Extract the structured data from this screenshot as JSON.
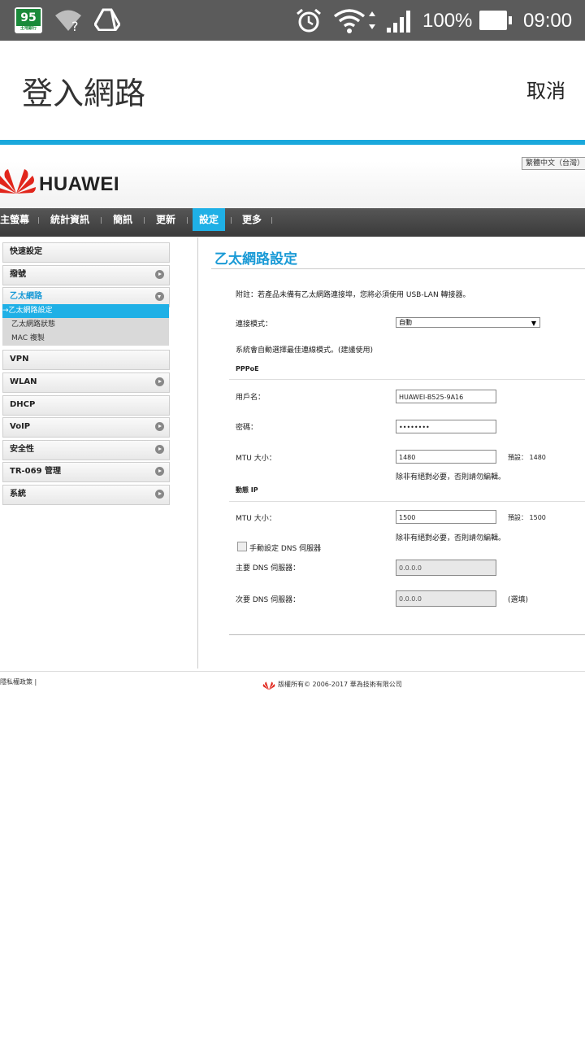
{
  "status_bar": {
    "app_icon_text": "95",
    "app_icon_subtext": "土地銀行",
    "battery_percent": "100%",
    "battery_level": 1.0,
    "time": "09:00",
    "icons": [
      "wifi-unknown-icon",
      "drive-icon",
      "alarm-icon",
      "wifi-icon",
      "signal-icon",
      "battery-icon"
    ]
  },
  "app_bar": {
    "title": "登入網路",
    "cancel_label": "取消",
    "accent_color": "#1aa8dc"
  },
  "router": {
    "language_selector": "繁體中文（台灣）",
    "brand": "HUAWEI",
    "nav": {
      "items": [
        {
          "label": "主螢幕"
        },
        {
          "label": "統計資訊"
        },
        {
          "label": "簡訊"
        },
        {
          "label": "更新"
        },
        {
          "label": "設定"
        },
        {
          "label": "更多"
        }
      ],
      "active_index": 4,
      "active_color": "#1fb0e6"
    },
    "sidebar": {
      "items": [
        {
          "label": "快速設定"
        },
        {
          "label": "撥號"
        },
        {
          "label": "乙太網路"
        },
        {
          "label": "VPN"
        },
        {
          "label": "WLAN"
        },
        {
          "label": "DHCP"
        },
        {
          "label": "VoIP"
        },
        {
          "label": "安全性"
        },
        {
          "label": "TR-069 管理"
        },
        {
          "label": "系統"
        }
      ],
      "sub_items": [
        {
          "label": "→乙太網路設定"
        },
        {
          "label": "乙太網路狀態"
        },
        {
          "label": "MAC 複製"
        }
      ]
    },
    "main": {
      "heading": "乙太網路設定",
      "note": "附註：若產品未備有乙太網路連接埠，您將必須使用 USB-LAN 轉接器。",
      "connection_mode_label": "連接模式：",
      "connection_mode_value": "自動",
      "auto_hint": "系統會自動選擇最佳連線模式。(建議使用)",
      "pppoe": {
        "section_label": "PPPoE",
        "username_label": "用戶名：",
        "username_value": "HUAWEI-B525-9A16",
        "password_label": "密碼：",
        "password_value": "••••••••",
        "mtu_label": "MTU 大小：",
        "mtu_value": "1480",
        "mtu_default": "預設： 1480",
        "mtu_hint": "除非有絕對必要，否則請勿編輯。"
      },
      "dynamic_ip": {
        "section_label": "動態 IP",
        "mtu_label": "MTU 大小：",
        "mtu_value": "1500",
        "mtu_default": "預設： 1500",
        "mtu_hint": "除非有絕對必要，否則請勿編輯。",
        "manual_dns_label": "手動設定 DNS 伺服器",
        "primary_dns_label": "主要 DNS 伺服器：",
        "primary_dns_value": "0.0.0.0",
        "secondary_dns_label": "次要 DNS 伺服器：",
        "secondary_dns_value": "0.0.0.0",
        "optional_label": "(選填)"
      }
    },
    "footer": {
      "privacy": "隱私權政策 |",
      "copyright": "版權所有© 2006-2017 華為技術有限公司"
    }
  }
}
